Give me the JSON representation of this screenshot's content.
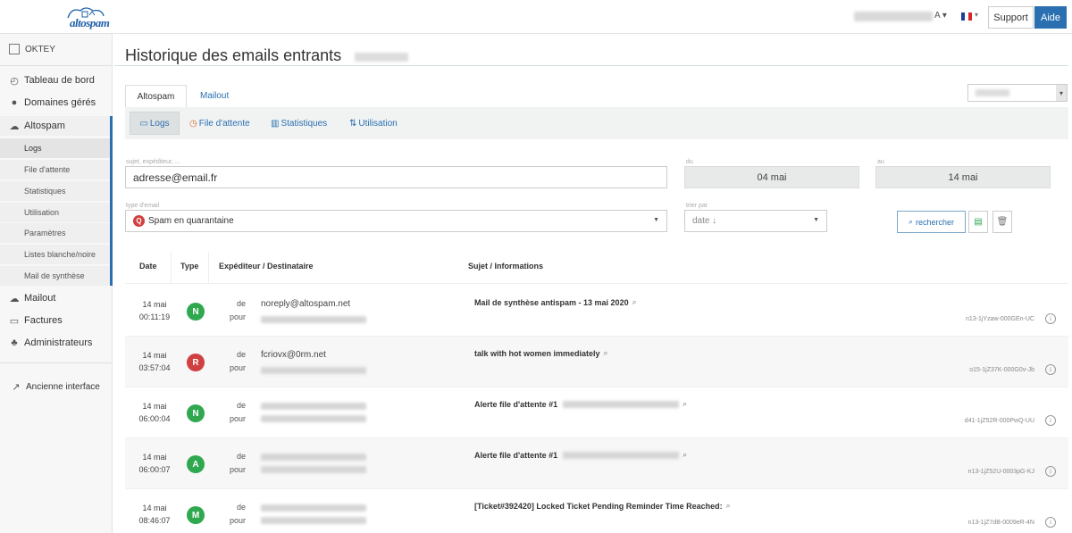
{
  "header": {
    "logo_text": "altospam",
    "user_caret": "A",
    "support_label": "Support",
    "help_label": "Aide"
  },
  "sidebar": {
    "org_name": "OKTEY",
    "items": [
      {
        "label": "Tableau de bord",
        "icon": "dashboard-icon"
      },
      {
        "label": "Domaines gérés",
        "icon": "globe-icon"
      },
      {
        "label": "Altospam",
        "icon": "cloud-icon"
      }
    ],
    "subitems": [
      "Logs",
      "File d'attente",
      "Statistiques",
      "Utilisation",
      "Paramètres",
      "Listes blanche/noire",
      "Mail de synthèse"
    ],
    "items_after": [
      {
        "label": "Mailout",
        "icon": "cloud-upload-icon"
      },
      {
        "label": "Factures",
        "icon": "invoice-icon"
      },
      {
        "label": "Administrateurs",
        "icon": "users-icon"
      }
    ],
    "old_interface_label": "Ancienne interface"
  },
  "main": {
    "title": "Historique des emails entrants",
    "tabs": [
      "Altospam",
      "Mailout"
    ],
    "subnav": [
      "Logs",
      "File d'attente",
      "Statistiques",
      "Utilisation"
    ],
    "filters": {
      "search_label": "sujet, expéditeur, ...",
      "search_value": "adresse@email.fr",
      "from_label": "du",
      "from_value": "04 mai",
      "to_label": "au",
      "to_value": "14 mai",
      "type_label": "type d'email",
      "type_value": "Spam en quarantaine",
      "type_badge": "Q",
      "sort_label": "trier par",
      "sort_value": "date ↓",
      "search_button": "rechercher"
    },
    "table": {
      "headers": [
        "Date",
        "Type",
        "Expéditeur / Destinataire",
        "Sujet / Informations"
      ],
      "from_word": "de",
      "to_word": "pour",
      "rows": [
        {
          "date": "14 mai",
          "time": "00:11:19",
          "type": "N",
          "type_color": "#2fa84f",
          "sender": "noreply@altospam.net",
          "subject": "Mail de synthèse antispam - 13 mai 2020",
          "id": "n13-1jYzaw-000GEn-UC"
        },
        {
          "date": "14 mai",
          "time": "03:57:04",
          "type": "R",
          "type_color": "#d04040",
          "sender": "fcriovx@0rm.net",
          "subject": "talk with hot women immediately",
          "id": "o15-1jZ37K-000G0v-Jb"
        },
        {
          "date": "14 mai",
          "time": "06:00:04",
          "type": "N",
          "type_color": "#2fa84f",
          "sender": "",
          "subject": "Alerte file d'attente #1",
          "id": "d41-1jZ52R-000PwQ-UU"
        },
        {
          "date": "14 mai",
          "time": "06:00:07",
          "type": "A",
          "type_color": "#2fa84f",
          "sender": "",
          "subject": "Alerte file d'attente #1",
          "id": "n13-1jZ52U-0003pG-KJ"
        },
        {
          "date": "14 mai",
          "time": "08:46:07",
          "type": "M",
          "type_color": "#2fa84f",
          "sender": "",
          "subject": "[Ticket#392420] Locked Ticket Pending Reminder Time Reached:",
          "id": "n13-1jZ7dB-0009eR-4N"
        }
      ]
    }
  }
}
